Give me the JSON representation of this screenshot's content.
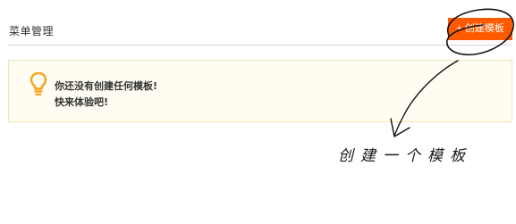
{
  "header": {
    "title": "菜单管理",
    "create_button": {
      "icon": "+",
      "label": "创建模板"
    }
  },
  "notice": {
    "icon": "lightbulb-icon",
    "line1": "你还没有创建任何模板!",
    "line2": "快来体验吧!"
  },
  "annotation": {
    "text": "创建一个模板"
  },
  "colors": {
    "accent": "#ff5a00",
    "bulb": "#f5a623",
    "notice_bg": "#fffdf1",
    "notice_border": "#f0e6b5"
  }
}
